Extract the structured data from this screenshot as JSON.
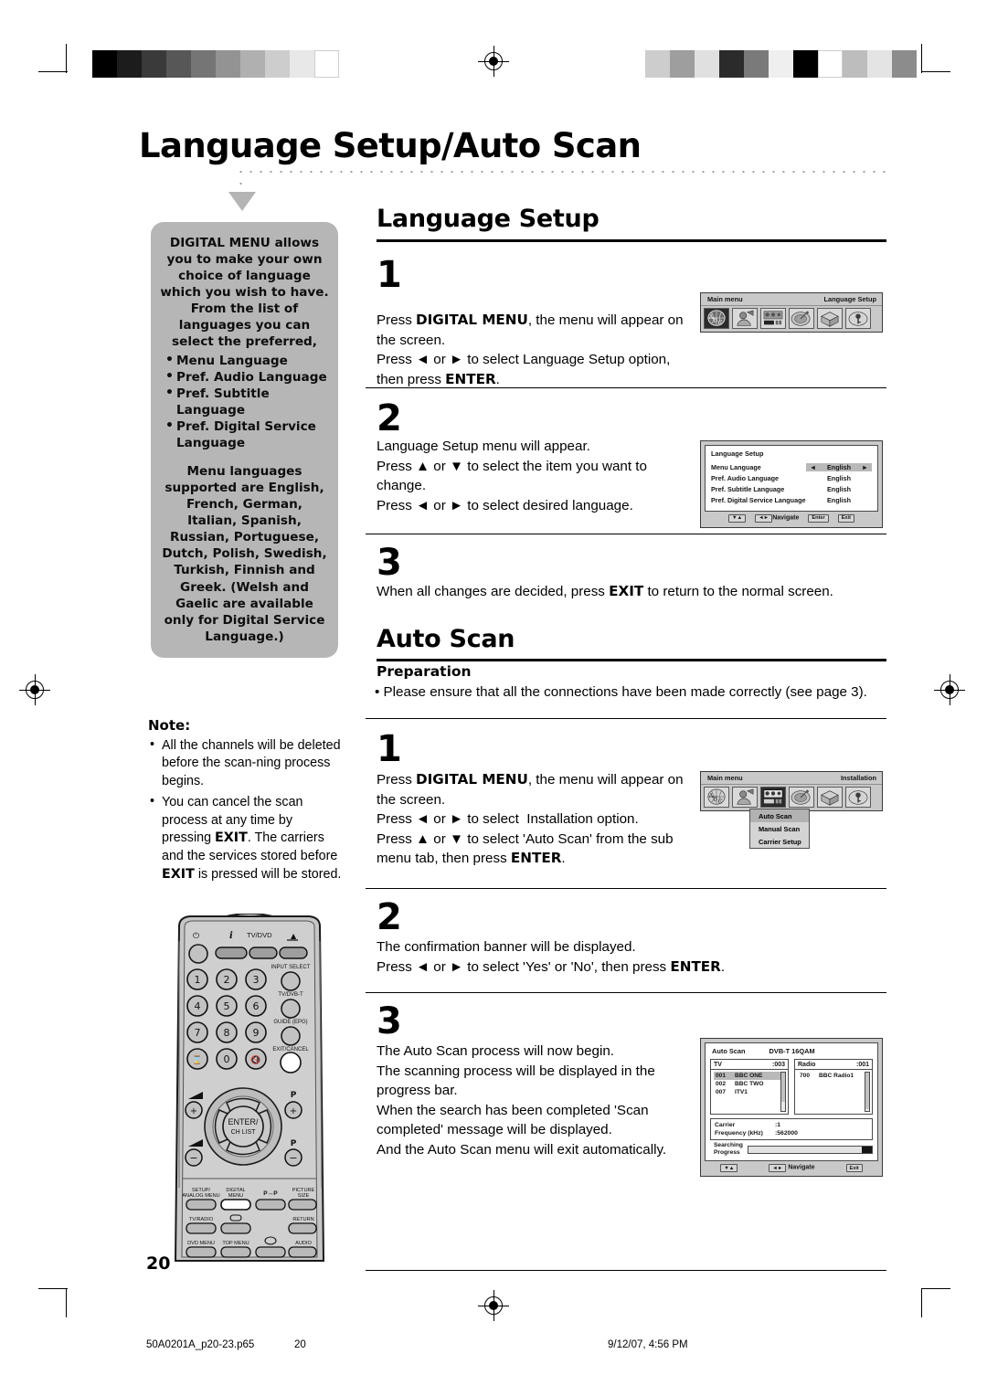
{
  "page": {
    "title": "Language Setup/Auto Scan",
    "number": "20"
  },
  "sidebar": {
    "intro": "DIGITAL MENU allows you to make your own choice of language which you wish to have. From the list of languages you can select the preferred,",
    "bullets": [
      "Menu Language",
      "Pref. Audio Language",
      "Pref. Subtitle Language",
      "Pref. Digital Service Language"
    ],
    "languages_note": "Menu languages supported are English, French, German, Italian, Spanish, Russian, Portuguese, Dutch, Polish, Swedish, Turkish, Finnish and Greek. (Welsh and Gaelic are available only for Digital Service Language.)"
  },
  "note": {
    "title": "Note:",
    "items": [
      "All the channels will be deleted before the scanning process begins.",
      "You can cancel the scan process at any time by pressing EXIT. The carriers and the services stored before EXIT is pressed will be stored."
    ]
  },
  "language_setup": {
    "heading": "Language Setup",
    "step1": {
      "number": "1",
      "lines": [
        "Press DIGITAL MENU, the menu will appear on the screen.",
        "Press ◄ or ► to select Language Setup option, then press ENTER."
      ]
    },
    "step2": {
      "number": "2",
      "lines": [
        "Language Setup menu will appear.",
        "Press ▲ or ▼ to select the item you want to change.",
        "Press ◄ or ► to select desired language."
      ]
    },
    "step3": {
      "number": "3",
      "lines": [
        "When all changes are decided, press EXIT to return to the normal screen."
      ]
    }
  },
  "auto_scan": {
    "heading": "Auto Scan",
    "preparation_title": "Preparation",
    "preparation_text": "Please ensure that all the connections have been made correctly (see page 3).",
    "step1": {
      "number": "1",
      "lines": [
        "Press DIGITAL MENU, the menu will appear on the screen.",
        "Press ◄ or ► to select  Installation option.",
        "Press ▲ or ▼ to select 'Auto Scan' from the sub menu tab, then press ENTER."
      ]
    },
    "step2": {
      "number": "2",
      "lines": [
        "The confirmation banner will be displayed.",
        "Press ◄ or ► to select 'Yes' or 'No', then press ENTER."
      ]
    },
    "step3": {
      "number": "3",
      "lines": [
        "The Auto Scan process will now begin.",
        "The scanning process will be displayed in the progress bar.",
        "When the search has been completed 'Scan completed' message will be displayed.",
        "And the Auto Scan menu will exit automatically."
      ]
    }
  },
  "osd_main_menu_language": {
    "left_label": "Main menu",
    "right_label": "Language Setup",
    "icons": [
      "abc-globe-icon",
      "person-tv-icon",
      "tuner-icon",
      "satellite-dish-icon",
      "box-icon",
      "lock-key-icon"
    ],
    "selected_icon_index": 0
  },
  "osd_language_setup": {
    "title": "Language Setup",
    "rows": [
      {
        "label": "Menu Language",
        "value": "English",
        "active": true
      },
      {
        "label": "Pref. Audio Language",
        "value": "English",
        "active": false
      },
      {
        "label": "Pref. Subtitle Language",
        "value": "English",
        "active": false
      },
      {
        "label": "Pref. Digital Service Language",
        "value": "English",
        "active": false
      }
    ],
    "footer": {
      "key_updown": "▼▲",
      "key_leftright": "◄►",
      "navigate_label": "Navigate",
      "key_enter": "Enter",
      "key_exit": "Exit"
    }
  },
  "osd_main_menu_installation": {
    "left_label": "Main menu",
    "right_label": "Installation",
    "icons": [
      "abc-globe-icon",
      "person-tv-icon",
      "tuner-icon",
      "satellite-dish-icon",
      "box-icon",
      "lock-key-icon"
    ],
    "selected_icon_index": 2,
    "submenu": [
      {
        "label": "Auto Scan",
        "highlighted": true
      },
      {
        "label": "Manual Scan",
        "highlighted": false
      },
      {
        "label": "Carrier Setup",
        "highlighted": false
      }
    ]
  },
  "osd_auto_scan": {
    "title": "Auto Scan",
    "mode": "DVB-T 16QAM",
    "tv": {
      "header": "TV",
      "count": ":003",
      "rows": [
        {
          "num": "001",
          "name": "BBC ONE",
          "highlighted": true
        },
        {
          "num": "002",
          "name": "BBC TWO",
          "highlighted": false
        },
        {
          "num": "007",
          "name": "ITV1",
          "highlighted": false
        }
      ]
    },
    "radio": {
      "header": "Radio",
      "count": ":001",
      "rows": [
        {
          "num": "700",
          "name": "BBC Radio1",
          "highlighted": false
        }
      ]
    },
    "carrier": {
      "label": "Carrier",
      "value": ":1"
    },
    "frequency": {
      "label": "Frequency (kHz)",
      "value": ":562000"
    },
    "searching_label": "Searching",
    "progress_label": "Progress",
    "footer": {
      "key_updown": "▼▲",
      "key_leftright": "◄►",
      "navigate_label": "Navigate",
      "key_exit": "Exit"
    }
  },
  "remote": {
    "top_labels": [
      "⏻",
      "i",
      "TV/DVD",
      "⏏"
    ],
    "numpad": [
      "1",
      "2",
      "3",
      "4",
      "5",
      "6",
      "7",
      "8",
      "9",
      "⌛",
      "0",
      "🔇"
    ],
    "right_labels": [
      "INPUT SELECT",
      "TV/DVB-T",
      "GUIDE (EPG)",
      "EXIT/CANCEL"
    ],
    "center_label_1": "ENTER/",
    "center_label_2": "CH LIST",
    "volume_up": "+",
    "volume_down": "-",
    "prog_label": "P",
    "bottom_rows": [
      [
        "SETUP/\nANALOG MENU",
        "DIGITAL\nMENU",
        "P↔P",
        "PICTURE\nSIZE"
      ],
      [
        "TV/RADIO",
        "▭",
        "",
        "RETURN"
      ],
      [
        "DVD MENU",
        "TOP MENU",
        "☺",
        "AUDIO"
      ]
    ]
  },
  "footer": {
    "filename": "50A0201A_p20-23.p65",
    "pagenum": "20",
    "timestamp": "9/12/07, 4:56 PM"
  },
  "colors": {
    "sidebar_bg": "#b6b6b6",
    "osd_bg": "#c9c9c9",
    "highlight": "#b9b9b9",
    "remote_body": "#c6c6c6"
  }
}
